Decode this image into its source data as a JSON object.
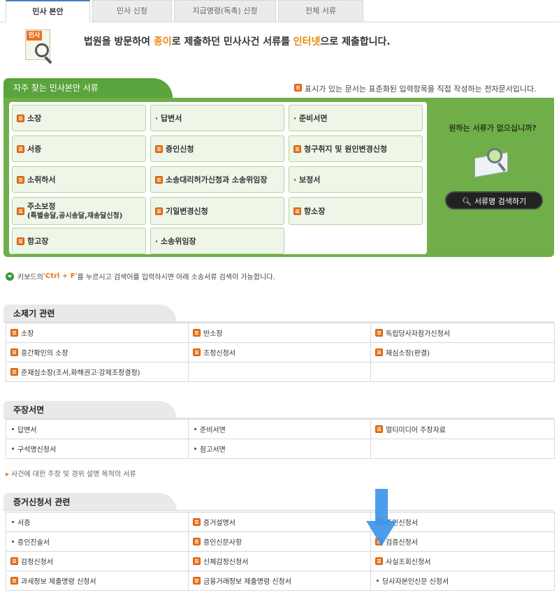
{
  "tabs": [
    {
      "label": "민사 본안",
      "active": true
    },
    {
      "label": "민사 신청",
      "active": false
    },
    {
      "label": "지급명령(독촉) 신청",
      "active": false
    },
    {
      "label": "전체 서류",
      "active": false
    }
  ],
  "header": {
    "icon_tag": "민사",
    "text_a": "법원을 방문하여 ",
    "text_hl1": "종이",
    "text_b": "로 제출하던 민사사건 서류를 ",
    "text_hl2": "인터넷",
    "text_c": "으로 제출합니다."
  },
  "frequent": {
    "title": "자주 찾는 민사본안 서류",
    "note": "표시가 있는 문서는 표준화된 입력항목을 직접 작성하는 전자문서입니다.",
    "side_question": "원하는 서류가 없으십니까?",
    "search_button": "서류명 검색하기",
    "items": [
      {
        "label": "소장",
        "icon": "doc"
      },
      {
        "label": "· 답변서",
        "icon": "bullet"
      },
      {
        "label": "· 준비서면",
        "icon": "bullet"
      },
      {
        "label": "서증",
        "icon": "doc"
      },
      {
        "label": "증인신청",
        "icon": "doc"
      },
      {
        "label": "청구취지 및 원인변경신청",
        "icon": "doc"
      },
      {
        "label": "소취하서",
        "icon": "doc"
      },
      {
        "label": "소송대리허가신청과 소송위임장",
        "icon": "doc"
      },
      {
        "label": "· 보정서",
        "icon": "bullet"
      },
      {
        "label": "주소보정",
        "label2": "(특별송달,공시송달,재송달신청)",
        "icon": "doc"
      },
      {
        "label": "기일변경신청",
        "icon": "doc"
      },
      {
        "label": "항소장",
        "icon": "doc"
      },
      {
        "label": "항고장",
        "icon": "doc"
      },
      {
        "label": "· 소송위임장",
        "icon": "bullet"
      }
    ]
  },
  "hint": {
    "text_a": "키보드의 ",
    "key": "'Ctrl + F'",
    "text_b": "를 누르시고 검색어를 입력하시면 아래 소송서류 검색이 가능합니다."
  },
  "sections": [
    {
      "title": "소제기 관련",
      "rows": [
        [
          {
            "label": "소장",
            "icon": "doc"
          },
          {
            "label": "반소장",
            "icon": "doc"
          },
          {
            "label": "독립당사자참가신청서",
            "icon": "doc"
          }
        ],
        [
          {
            "label": "중간확인의 소장",
            "icon": "doc"
          },
          {
            "label": "조정신청서",
            "icon": "doc"
          },
          {
            "label": "재심소장(판결)",
            "icon": "doc"
          }
        ],
        [
          {
            "label": "준재심소장(조서,화해권고·강제조정결정)",
            "icon": "doc"
          },
          {
            "label": "",
            "icon": "none"
          },
          {
            "label": "",
            "icon": "none"
          }
        ]
      ]
    },
    {
      "title": "주장서면",
      "rows": [
        [
          {
            "label": "답변서",
            "icon": "bullet"
          },
          {
            "label": "준비서면",
            "icon": "bullet"
          },
          {
            "label": "멀티미디어 주장자료",
            "icon": "doc"
          }
        ],
        [
          {
            "label": "구석명신청서",
            "icon": "bullet"
          },
          {
            "label": "참고서면",
            "icon": "bullet"
          },
          {
            "label": "",
            "icon": "none"
          }
        ]
      ],
      "note": "사건에 대한 주장 및 경위 설명 목적의 서류"
    },
    {
      "title": "증거신청서 관련",
      "rows": [
        [
          {
            "label": "서증",
            "icon": "bullet"
          },
          {
            "label": "증거설명서",
            "icon": "doc"
          },
          {
            "label": "증인신청서",
            "icon": "doc"
          }
        ],
        [
          {
            "label": "증인진술서",
            "icon": "bullet"
          },
          {
            "label": "증인신문사항",
            "icon": "doc"
          },
          {
            "label": "검증신청서",
            "icon": "doc"
          }
        ],
        [
          {
            "label": "감정신청서",
            "icon": "doc"
          },
          {
            "label": "신체감정신청서",
            "icon": "doc"
          },
          {
            "label": "사실조회신청서",
            "icon": "doc"
          }
        ],
        [
          {
            "label": "과세정보 제출명령 신청서",
            "icon": "doc"
          },
          {
            "label": "금융거래정보 제출명령 신청서",
            "icon": "doc"
          },
          {
            "label": "당사자본인신문 신청서",
            "icon": "bullet"
          }
        ]
      ]
    }
  ],
  "colors": {
    "accent_green": "#6fae48",
    "doc_icon": "#e8731c",
    "arrow_blue": "#3d95e8"
  }
}
